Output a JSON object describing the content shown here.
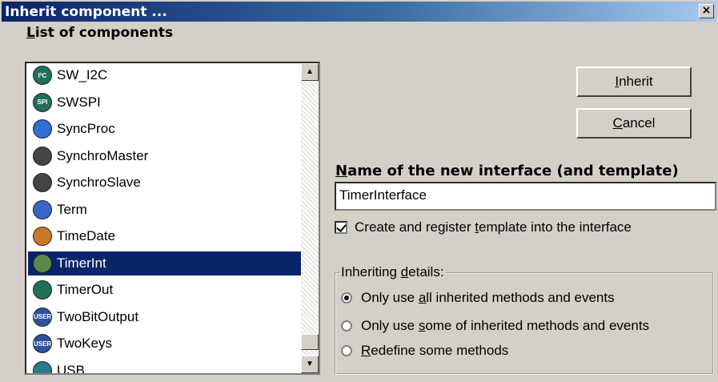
{
  "window": {
    "title": "Inherit component ...",
    "close_glyph": "×"
  },
  "list": {
    "label": "List of components",
    "label_accel": "L",
    "items": [
      {
        "label": "SW_I2C",
        "icon": "i2c-icon",
        "icon_text": "I²C",
        "color": "#1f6f5a",
        "selected": false
      },
      {
        "label": "SWSPI",
        "icon": "spi-icon",
        "icon_text": "SPI",
        "color": "#1f6f5a",
        "selected": false
      },
      {
        "label": "SyncProc",
        "icon": "monitor-icon",
        "icon_text": "",
        "color": "#2f6fd6",
        "selected": false
      },
      {
        "label": "SynchroMaster",
        "icon": "phone-icon",
        "icon_text": "",
        "color": "#444444",
        "selected": false
      },
      {
        "label": "SynchroSlave",
        "icon": "phone-icon",
        "icon_text": "",
        "color": "#444444",
        "selected": false
      },
      {
        "label": "Term",
        "icon": "terminal-icon",
        "icon_text": "",
        "color": "#3a64c8",
        "selected": false
      },
      {
        "label": "TimeDate",
        "icon": "clock-icon",
        "icon_text": "",
        "color": "#c87a2a",
        "selected": false
      },
      {
        "label": "TimerInt",
        "icon": "timer-icon",
        "icon_text": "",
        "color": "#5a8a4a",
        "selected": true
      },
      {
        "label": "TimerOut",
        "icon": "pulse-icon",
        "icon_text": "",
        "color": "#1f6f5a",
        "selected": false
      },
      {
        "label": "TwoBitOutput",
        "icon": "user-badge-icon",
        "icon_text": "USER",
        "color": "#3050a0",
        "selected": false
      },
      {
        "label": "TwoKeys",
        "icon": "user-badge-icon",
        "icon_text": "USER",
        "color": "#3050a0",
        "selected": false
      },
      {
        "label": "USB",
        "icon": "usb-icon",
        "icon_text": "",
        "color": "#2a7a8a",
        "selected": false
      }
    ]
  },
  "buttons": {
    "inherit": "Inherit",
    "inherit_accel": "I",
    "cancel": "Cancel",
    "cancel_accel": "C"
  },
  "name_field": {
    "label": "Name of the new interface (and template)",
    "label_accel": "N",
    "value": "TimerInterface"
  },
  "register_checkbox": {
    "label_pre": "Create and register ",
    "label_accel": "t",
    "label_post": "emplate into the interface",
    "checked": true
  },
  "details": {
    "legend_pre": "Inheriting ",
    "legend_accel": "d",
    "legend_post": "etails:",
    "options": [
      {
        "pre": "Only use ",
        "accel": "a",
        "post": "ll inherited methods and events",
        "selected": true
      },
      {
        "pre": "Only use ",
        "accel": "s",
        "post": "ome of inherited methods and events",
        "selected": false
      },
      {
        "pre": "",
        "accel": "R",
        "post": "edefine some methods",
        "selected": false
      }
    ]
  }
}
